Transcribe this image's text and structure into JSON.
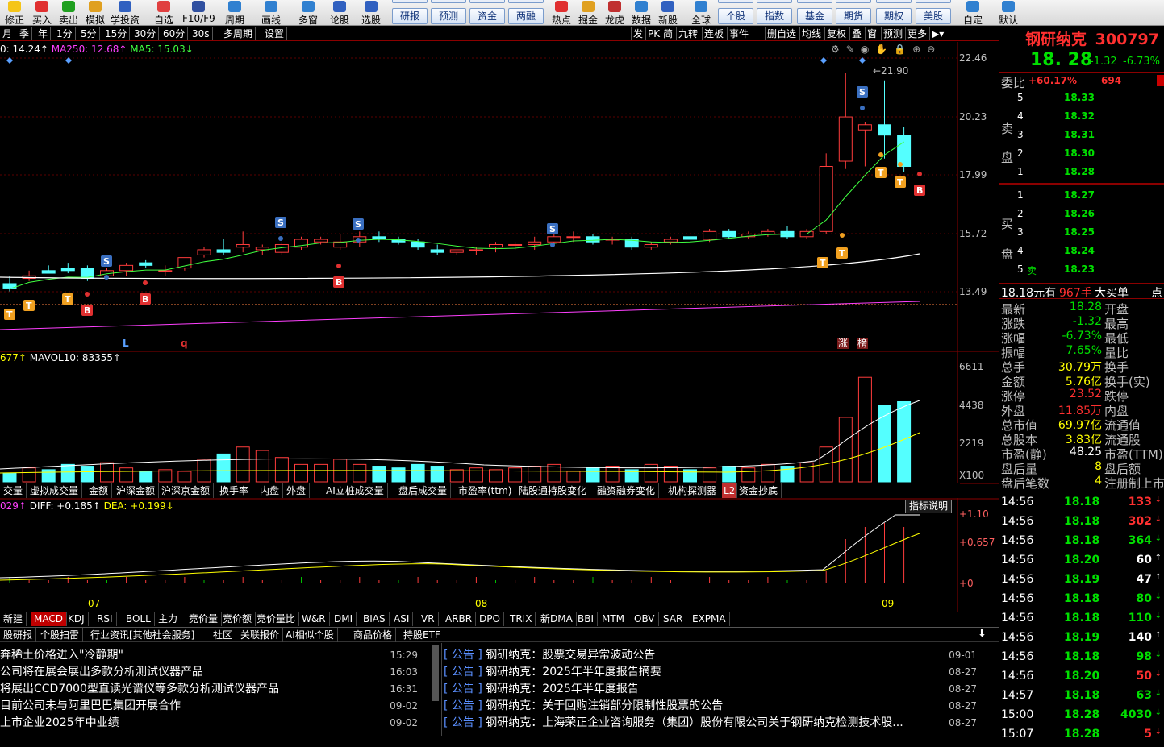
{
  "toolbar": {
    "items": [
      "修正",
      "买入",
      "卖出",
      "模拟",
      "学投资",
      "自选",
      "F10/F9",
      "周期",
      "画线",
      "多窗",
      "论股",
      "选股",
      "热点",
      "掘金",
      "龙虎",
      "数据",
      "新股",
      "全球",
      "自定",
      "默认"
    ],
    "buttons": [
      "研报",
      "预测",
      "资金",
      "两融",
      "个股",
      "指数",
      "基金",
      "期货",
      "期权",
      "美股"
    ]
  },
  "periods": [
    "月",
    "季",
    "年",
    "1分",
    "5分",
    "15分",
    "30分",
    "60分",
    "30s",
    "多周期",
    "设置"
  ],
  "periods_right": [
    "发",
    "PK",
    "简",
    "九转",
    "连板",
    "事件",
    "删自选",
    "均线",
    "复权",
    "叠",
    "窗",
    "预测",
    "更多"
  ],
  "ma_line": {
    "c": "0: 14.24↑",
    "ma250": "MA250: 12.68↑",
    "ma5": "MA5: 15.03↓"
  },
  "price_axis": [
    "22.46",
    "20.23",
    "17.99",
    "15.72",
    "13.49"
  ],
  "vol_axis": [
    "6611",
    "4438",
    "2219",
    "X100"
  ],
  "macd_axis": [
    "+1.10",
    "+0.657",
    "+0"
  ],
  "vol_line": {
    "a": "677↑",
    "mavol10": "MAVOL10: 83355↑"
  },
  "macd_line": {
    "a": "029↑",
    "diff": "DIFF: +0.185↑",
    "dea": "DEA: +0.199↓"
  },
  "macd_btn": "指标说明",
  "high_label": "21.90",
  "months": [
    "07",
    "08",
    "09"
  ],
  "chart_markers": {
    "L": "L",
    "q": "q",
    "zhang": "涨",
    "bang": "榜",
    "S": "S",
    "T": "T",
    "B": "B"
  },
  "tabs_indicators": [
    "交量",
    "虚拟成交量",
    "金额",
    "沪深金额",
    "沪深京金额",
    "换手率",
    "内盘",
    "外盘",
    "AI立桩成交量",
    "盘后成交量",
    "市盈率(ttm)",
    "陆股通持股变化",
    "融资融券变化",
    "机构探测器",
    "L2",
    "资金抄底"
  ],
  "tabs_bottom": [
    "新建",
    "MACD",
    "KDJ",
    "RSI",
    "BOLL",
    "主力",
    "竞价量",
    "竞价额",
    "竞价量比",
    "W&R",
    "DMI",
    "BIAS",
    "ASI",
    "VR",
    "ARBR",
    "DPO",
    "TRIX",
    "新DMA",
    "BBI",
    "MTM",
    "OBV",
    "SAR",
    "EXPMA"
  ],
  "news_tabs": [
    "股研报",
    "个股扫雷",
    "行业资讯[其他社会服务]",
    "社区",
    "关联报价",
    "AI相似个股",
    "商品价格",
    "持股ETF"
  ],
  "news_left": [
    {
      "t": "奔稀土价格进入\"冷静期\"",
      "d": "15:29"
    },
    {
      "t": "公司将在展会展出多款分析测试仪器产品",
      "d": "16:03"
    },
    {
      "t": "将展出CCD7000型直读光谱仪等多款分析测试仪器产品",
      "d": "16:31"
    },
    {
      "t": "目前公司未与阿里巴巴集团开展合作",
      "d": "09-02"
    },
    {
      "t": "上市企业2025年中业绩",
      "d": "09-02"
    }
  ],
  "news_right": [
    {
      "g": "公告",
      "t": "钢研纳克：股票交易异常波动公告",
      "d": "09-01"
    },
    {
      "g": "公告",
      "t": "钢研纳克：2025年半年度报告摘要",
      "d": "08-27"
    },
    {
      "g": "公告",
      "t": "钢研纳克：2025年半年度报告",
      "d": "08-27"
    },
    {
      "g": "公告",
      "t": "钢研纳克：关于回购注销部分限制性股票的公告",
      "d": "08-27"
    },
    {
      "g": "公告",
      "t": "钢研纳克：上海荣正企业咨询服务（集团）股份有限公司关于钢研纳克检测技术股...",
      "d": "08-27"
    }
  ],
  "stock": {
    "name": "钢研纳克",
    "code": "300797",
    "price": "18. 28",
    "chg": "-1.32",
    "pct": "-6.73%"
  },
  "weibi": {
    "label": "委比",
    "val": "+60.17%",
    "n": "694"
  },
  "sell_label": "卖盘",
  "buy_label": "买盘",
  "sells": [
    {
      "l": "5",
      "p": "18.33"
    },
    {
      "l": "4",
      "p": "18.32"
    },
    {
      "l": "3",
      "p": "18.31"
    },
    {
      "l": "2",
      "p": "18.30"
    },
    {
      "l": "1",
      "p": "18.28"
    }
  ],
  "buys": [
    {
      "l": "1",
      "p": "18.27"
    },
    {
      "l": "2",
      "p": "18.26"
    },
    {
      "l": "3",
      "p": "18.25"
    },
    {
      "l": "4",
      "p": "18.24"
    },
    {
      "l": "5",
      "p": "18.23",
      "x": "卖"
    }
  ],
  "bigorder": {
    "a": "18.18元有",
    "b": "967手",
    "c": "大买单",
    "d": "点"
  },
  "fields": [
    {
      "a": "最新",
      "v": "18.28",
      "b": "开盘",
      "c": "#00e000"
    },
    {
      "a": "涨跌",
      "v": "-1.32",
      "b": "最高",
      "c": "#00e000"
    },
    {
      "a": "涨幅",
      "v": "-6.73%",
      "b": "最低",
      "c": "#00e000"
    },
    {
      "a": "振幅",
      "v": "7.65%",
      "b": "量比",
      "c": "#00e000"
    },
    {
      "a": "总手",
      "v": "30.79万",
      "b": "换手",
      "c": "#ffff00"
    },
    {
      "a": "金额",
      "v": "5.76亿",
      "b": "换手(实)",
      "c": "#ffff00"
    },
    {
      "a": "涨停",
      "v": "23.52",
      "b": "跌停",
      "c": "#ff3030"
    },
    {
      "a": "外盘",
      "v": "11.85万",
      "b": "内盘",
      "c": "#ff3030"
    },
    {
      "a": "总市值",
      "v": "69.97亿",
      "b": "流通值",
      "c": "#ffff00"
    },
    {
      "a": "总股本",
      "v": "3.83亿",
      "b": "流通股",
      "c": "#ffff00"
    },
    {
      "a": "市盈(静)",
      "v": "48.25",
      "b": "市盈(TTM)",
      "c": "#ffffff"
    },
    {
      "a": "盘后量",
      "v": "8",
      "b": "盘后额",
      "c": "#ffff00"
    },
    {
      "a": "盘后笔数",
      "v": "4",
      "b": "注册制上市",
      "c": "#ffff00"
    }
  ],
  "ticks": [
    {
      "t": "14:56",
      "p": "18.18",
      "v": "133",
      "c": "#ff3030",
      "a": "↓"
    },
    {
      "t": "14:56",
      "p": "18.18",
      "v": "302",
      "c": "#ff3030",
      "a": "↓"
    },
    {
      "t": "14:56",
      "p": "18.18",
      "v": "364",
      "c": "#00e000",
      "a": "↓"
    },
    {
      "t": "14:56",
      "p": "18.20",
      "v": "60",
      "c": "#ffffff",
      "a": "↑"
    },
    {
      "t": "14:56",
      "p": "18.19",
      "v": "47",
      "c": "#ffffff",
      "a": "↑"
    },
    {
      "t": "14:56",
      "p": "18.18",
      "v": "80",
      "c": "#00e000",
      "a": "↓"
    },
    {
      "t": "14:56",
      "p": "18.18",
      "v": "110",
      "c": "#00e000",
      "a": "↓"
    },
    {
      "t": "14:56",
      "p": "18.19",
      "v": "140",
      "c": "#ffffff",
      "a": "↑"
    },
    {
      "t": "14:56",
      "p": "18.18",
      "v": "98",
      "c": "#00e000",
      "a": "↓"
    },
    {
      "t": "14:56",
      "p": "18.20",
      "v": "50",
      "c": "#ff3030",
      "a": "↓"
    },
    {
      "t": "14:57",
      "p": "18.18",
      "v": "63",
      "c": "#00e000",
      "a": "↓"
    },
    {
      "t": "15:00",
      "p": "18.28",
      "v": "4030",
      "c": "#00e000",
      "a": "↓"
    },
    {
      "t": "15:07",
      "p": "18.28",
      "v": "5",
      "c": "#ff3030",
      "a": "↓"
    }
  ],
  "chart_data": {
    "type": "candlestick",
    "candles": [
      [
        13.8,
        14.1,
        13.6,
        13.5
      ],
      [
        14.0,
        14.3,
        14.1,
        13.9
      ],
      [
        14.3,
        14.5,
        14.2,
        14.2
      ],
      [
        14.4,
        14.6,
        14.3,
        14.2
      ],
      [
        14.4,
        14.5,
        14.0,
        13.9
      ],
      [
        14.1,
        14.4,
        14.3,
        14.0
      ],
      [
        14.3,
        14.6,
        14.5,
        14.1
      ],
      [
        14.6,
        14.7,
        14.5,
        14.4
      ],
      [
        14.3,
        14.5,
        14.3,
        14.1
      ],
      [
        14.4,
        14.8,
        14.8,
        14.3
      ],
      [
        14.9,
        15.2,
        15.1,
        14.8
      ],
      [
        15.1,
        15.5,
        15.0,
        14.9
      ],
      [
        15.2,
        15.8,
        15.3,
        15.0
      ],
      [
        15.1,
        15.3,
        15.2,
        14.9
      ],
      [
        15.0,
        15.4,
        15.3,
        14.9
      ],
      [
        15.2,
        15.6,
        15.5,
        15.1
      ],
      [
        15.4,
        15.6,
        15.5,
        15.3
      ],
      [
        15.2,
        15.7,
        15.4,
        15.1
      ],
      [
        15.4,
        15.8,
        15.6,
        15.2
      ],
      [
        15.6,
        15.8,
        15.5,
        15.4
      ],
      [
        15.5,
        15.6,
        15.4,
        15.3
      ],
      [
        15.4,
        15.5,
        15.2,
        15.1
      ],
      [
        15.1,
        15.3,
        15.0,
        14.9
      ],
      [
        15.0,
        15.1,
        15.1,
        14.9
      ],
      [
        15.1,
        15.2,
        15.1,
        14.9
      ],
      [
        15.2,
        15.4,
        15.3,
        15.0
      ],
      [
        15.3,
        15.4,
        15.3,
        15.1
      ],
      [
        15.3,
        15.6,
        15.4,
        15.1
      ],
      [
        15.4,
        15.7,
        15.6,
        15.3
      ],
      [
        15.6,
        15.8,
        15.6,
        15.4
      ],
      [
        15.6,
        15.7,
        15.4,
        15.3
      ],
      [
        15.5,
        15.6,
        15.5,
        15.3
      ],
      [
        15.5,
        15.6,
        15.2,
        15.1
      ],
      [
        15.2,
        15.4,
        15.3,
        15.1
      ],
      [
        15.4,
        15.6,
        15.5,
        15.3
      ],
      [
        15.6,
        15.7,
        15.5,
        15.4
      ],
      [
        15.5,
        15.9,
        15.8,
        15.4
      ],
      [
        15.8,
        15.9,
        15.6,
        15.5
      ],
      [
        15.6,
        15.8,
        15.7,
        15.5
      ],
      [
        15.7,
        15.9,
        15.8,
        15.6
      ],
      [
        15.8,
        16.0,
        15.6,
        15.5
      ],
      [
        15.6,
        15.9,
        15.8,
        15.5
      ],
      [
        15.8,
        18.8,
        18.3,
        15.7
      ],
      [
        18.5,
        21.9,
        20.2,
        18.2
      ],
      [
        19.7,
        20.0,
        19.9,
        18.3
      ],
      [
        19.9,
        21.6,
        19.5,
        18.6
      ],
      [
        19.5,
        19.8,
        18.3,
        18.1
      ]
    ],
    "ylim": [
      12.5,
      23.0
    ],
    "ma": {
      "MA5": "15.03",
      "MA250": "12.68"
    },
    "volume_ylim": [
      0,
      6611
    ],
    "x_labels": [
      "07",
      "08",
      "09"
    ]
  }
}
